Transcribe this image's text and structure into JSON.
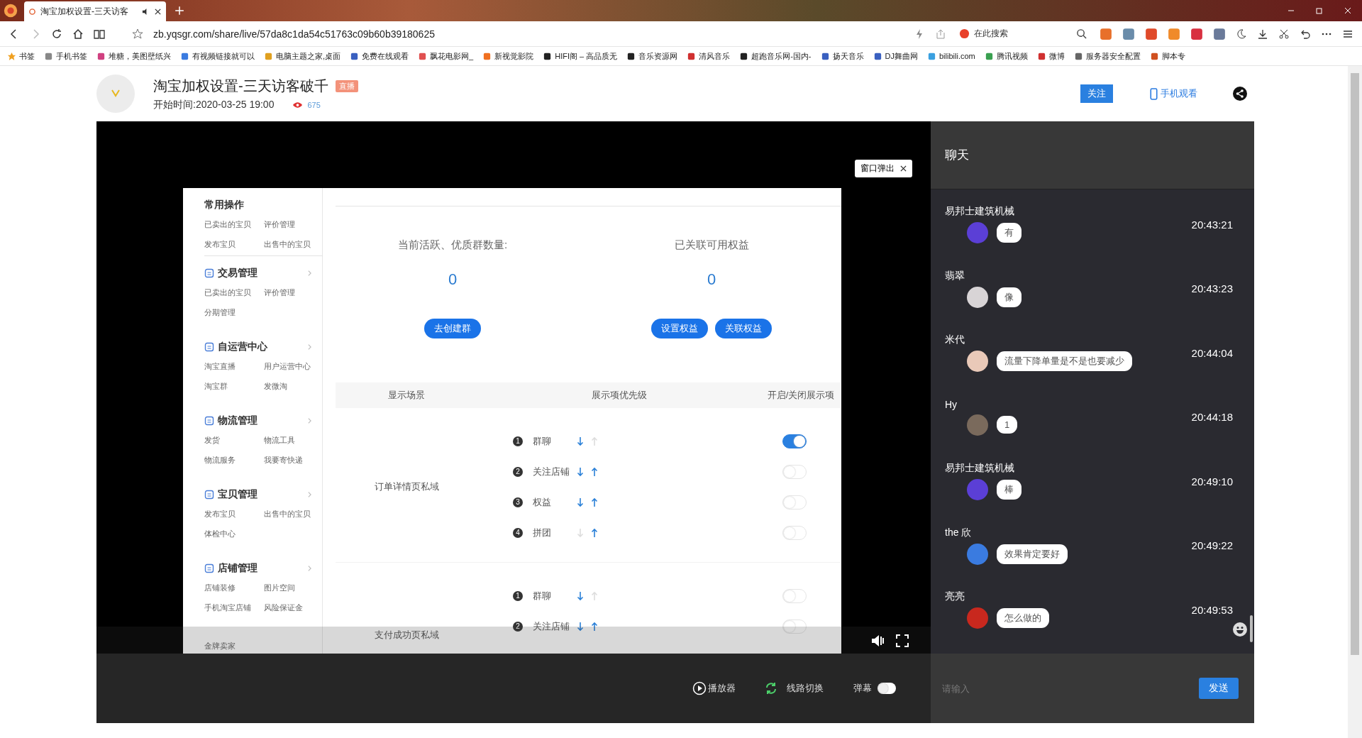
{
  "browser": {
    "tab_title": "淘宝加权设置-三天访客",
    "url": "zb.yqsgr.com/share/live/57da8c1da54c51763c09b60b39180625",
    "search_placeholder": "在此搜索",
    "bookmarks": [
      "书签",
      "手机书签",
      "堆糖，美图壁纸兴",
      "有视频链接就可以",
      "电脑主题之家,桌面",
      "免费在线观看",
      "飘花电影网_",
      "新视觉影院",
      "HIFI阁 – 高品质无",
      "音乐资源网",
      "清风音乐",
      "超跑音乐网-国内-",
      "扬天音乐",
      "DJ舞曲网",
      "bilibili.com",
      "腾讯视频",
      "微博",
      "服务器安全配置",
      "脚本专"
    ]
  },
  "header": {
    "title": "淘宝加权设置-三天访客破千",
    "badge": "直播",
    "start_time": "开始时间:2020-03-25 19:00",
    "views": "675",
    "follow": "关注",
    "mobile": "手机观看"
  },
  "video": {
    "popout": "窗口弹出",
    "sidebar": [
      {
        "kind": "plain",
        "title": "常用操作",
        "links": [
          "已卖出的宝贝",
          "评价管理",
          "发布宝贝",
          "出售中的宝贝"
        ]
      },
      {
        "kind": "group",
        "title": "交易管理",
        "links": [
          "已卖出的宝贝",
          "评价管理",
          "分期管理"
        ]
      },
      {
        "kind": "group",
        "title": "自运营中心",
        "links": [
          "淘宝直播",
          "用户运营中心",
          "淘宝群",
          "发微淘"
        ]
      },
      {
        "kind": "group",
        "title": "物流管理",
        "links": [
          "发货",
          "物流工具",
          "物流服务",
          "我要寄快递"
        ]
      },
      {
        "kind": "group",
        "title": "宝贝管理",
        "links": [
          "发布宝贝",
          "出售中的宝贝",
          "体检中心"
        ]
      },
      {
        "kind": "group",
        "title": "店铺管理",
        "links": [
          "店铺装修",
          "图片空间",
          "手机淘宝店铺",
          "风险保证金"
        ]
      },
      {
        "kind": "plain",
        "links": [
          "金牌卖家"
        ]
      }
    ],
    "stats": [
      {
        "label": "当前活跃、优质群数量:",
        "value": "0",
        "buttons": [
          "去创建群"
        ]
      },
      {
        "label": "已关联可用权益",
        "value": "0",
        "buttons": [
          "设置权益",
          "关联权益"
        ]
      }
    ],
    "columns": [
      "显示场景",
      "展示项优先级",
      "开启/关闭展示项"
    ],
    "groups": [
      {
        "scene": "订单详情页私域",
        "items": [
          {
            "index": "1",
            "name": "群聊",
            "down": true,
            "up": false,
            "on": true
          },
          {
            "index": "2",
            "name": "关注店铺",
            "down": true,
            "up": true,
            "on": false
          },
          {
            "index": "3",
            "name": "权益",
            "down": true,
            "up": true,
            "on": false
          },
          {
            "index": "4",
            "name": "拼团",
            "down": false,
            "up": true,
            "on": false
          }
        ]
      },
      {
        "scene": "支付成功页私域",
        "items": [
          {
            "index": "1",
            "name": "群聊",
            "down": true,
            "up": false,
            "on": false
          },
          {
            "index": "2",
            "name": "关注店铺",
            "down": true,
            "up": true,
            "on": false
          }
        ]
      }
    ]
  },
  "controls": {
    "player": "播放器",
    "line_switch": "线路切换",
    "danmaku": "弹幕",
    "danmaku_on": false
  },
  "chat": {
    "title": "聊天",
    "input_placeholder": "请输入",
    "send": "发送",
    "messages": [
      {
        "user": "易邦士建筑机械",
        "text": "有",
        "time": "20:43:21",
        "color": "#5b3fd6"
      },
      {
        "user": "翡翠",
        "text": "像",
        "time": "20:43:23",
        "color": "#d8d4d6"
      },
      {
        "user": "米代",
        "text": "流量下降单量是不是也要减少",
        "time": "20:44:04",
        "color": "#e9c9b8"
      },
      {
        "user": "Hy",
        "text": "1",
        "time": "20:44:18",
        "color": "#7a6a5c"
      },
      {
        "user": "易邦士建筑机械",
        "text": "棒",
        "time": "20:49:10",
        "color": "#5b3fd6"
      },
      {
        "user": "the 欣",
        "text": "效果肯定要好",
        "time": "20:49:22",
        "color": "#3a7be0"
      },
      {
        "user": "亮亮",
        "text": "怎么做的",
        "time": "20:49:53",
        "color": "#c8281e"
      }
    ]
  }
}
